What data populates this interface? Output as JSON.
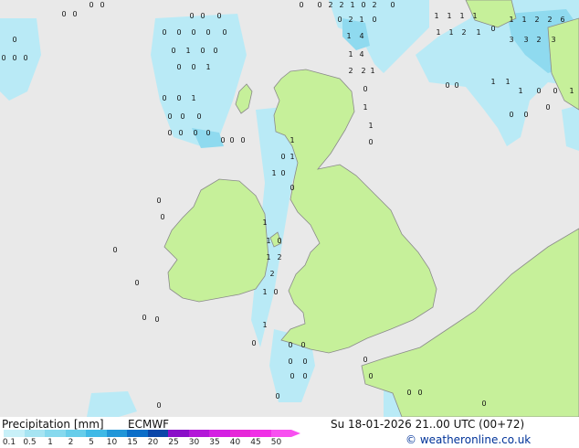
{
  "legend": {
    "title": "Precipitation [mm]",
    "model": "ECMWF",
    "valid_time": "Su 18-01-2026 21..00 UTC (00+72)",
    "credit": "© weatheronline.co.uk",
    "scale_labels": [
      "0.1",
      "0.5",
      "1",
      "2",
      "5",
      "10",
      "15",
      "20",
      "25",
      "30",
      "35",
      "40",
      "45",
      "50"
    ],
    "scale_colors": [
      "#c8f0f8",
      "#a6e4f2",
      "#86d9ee",
      "#66cdea",
      "#3fb9e6",
      "#2196d8",
      "#0b6ec8",
      "#0a46a8",
      "#8a10c8",
      "#b318d8",
      "#d420e2",
      "#e628d8",
      "#f030e6",
      "#f850f0"
    ]
  },
  "map_values": [
    "0",
    "1",
    "2",
    "3",
    "4",
    "6"
  ]
}
